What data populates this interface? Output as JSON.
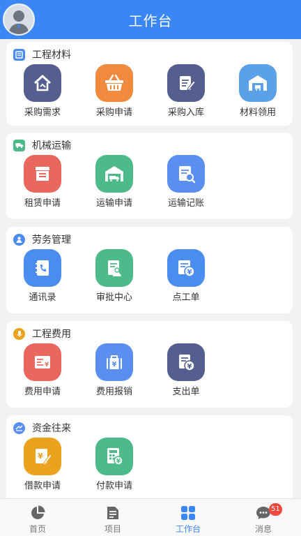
{
  "header": {
    "title": "工作台"
  },
  "colors": {
    "primary": "#3b86f5",
    "badge": "#f0483e"
  },
  "sections": [
    {
      "title": "工程材料",
      "icon": "materials-icon",
      "items": [
        {
          "label": "采购需求",
          "icon": "purchase-demand-icon",
          "color": "#555f8f"
        },
        {
          "label": "采购申请",
          "icon": "shopping-basket-icon",
          "color": "#f28a3d"
        },
        {
          "label": "采购入库",
          "icon": "stock-in-icon",
          "color": "#555f8f"
        },
        {
          "label": "材料领用",
          "icon": "warehouse-icon",
          "color": "#5aa1ea"
        }
      ]
    },
    {
      "title": "机械运输",
      "icon": "truck-section-icon",
      "items": [
        {
          "label": "租赁申请",
          "icon": "lease-shop-icon",
          "color": "#e9675d"
        },
        {
          "label": "运输申请",
          "icon": "transport-garage-icon",
          "color": "#4dba8a"
        },
        {
          "label": "运输记账",
          "icon": "transport-ledger-icon",
          "color": "#5a8ff0"
        }
      ]
    },
    {
      "title": "劳务管理",
      "icon": "labor-section-icon",
      "items": [
        {
          "label": "通讯录",
          "icon": "contacts-book-icon",
          "color": "#4a8cf0"
        },
        {
          "label": "审批中心",
          "icon": "approval-doc-icon",
          "color": "#4dba8a"
        },
        {
          "label": "点工单",
          "icon": "work-order-yuan-icon",
          "color": "#4a8cf0"
        }
      ]
    },
    {
      "title": "工程费用",
      "icon": "expense-section-icon",
      "items": [
        {
          "label": "费用申请",
          "icon": "expense-card-icon",
          "color": "#e9675d"
        },
        {
          "label": "费用报销",
          "icon": "reimburse-bag-icon",
          "color": "#5a8ff0"
        },
        {
          "label": "支出单",
          "icon": "payment-doc-icon",
          "color": "#555f8f"
        }
      ]
    },
    {
      "title": "资金往来",
      "icon": "funds-section-icon",
      "items": [
        {
          "label": "借款申请",
          "icon": "loan-note-icon",
          "color": "#eba21e"
        },
        {
          "label": "付款申请",
          "icon": "calculator-icon",
          "color": "#4dba8a"
        }
      ]
    }
  ],
  "tabs": [
    {
      "label": "首页",
      "icon": "pie-chart-icon"
    },
    {
      "label": "项目",
      "icon": "document-icon"
    },
    {
      "label": "工作台",
      "icon": "grid-icon",
      "active": true
    },
    {
      "label": "消息",
      "icon": "chat-bubble-icon",
      "badge": "51"
    }
  ]
}
